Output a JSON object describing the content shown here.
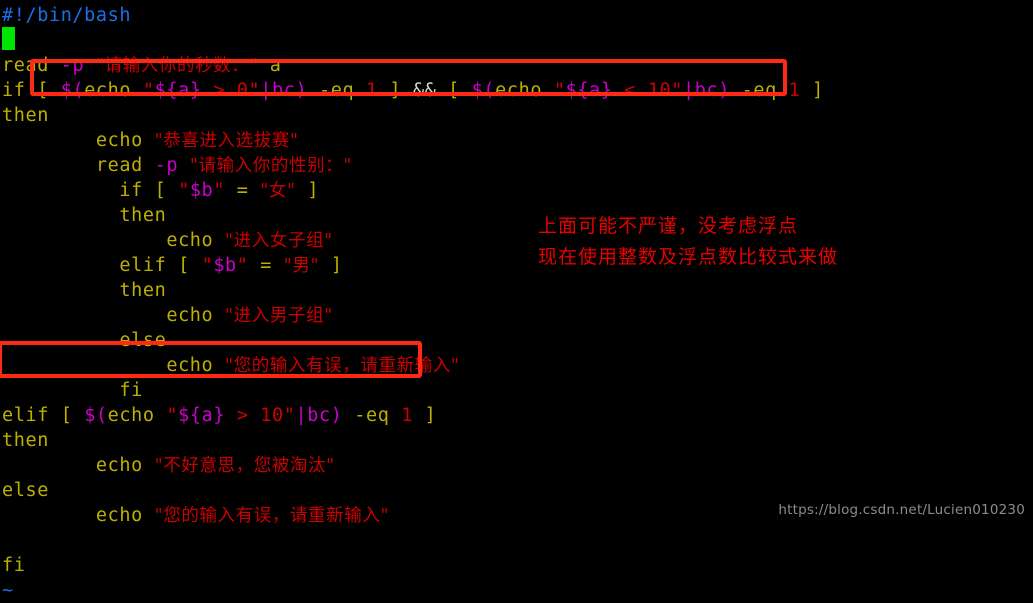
{
  "terminal": {
    "background": "#000000",
    "cursor_color": "#00e500",
    "colors": {
      "comment_blue": "#1a6fe8",
      "keyword_yellow": "#bdb000",
      "string_red": "#cc0000",
      "variable_magenta": "#cc00cc",
      "plain_white": "#d8d8d8",
      "highlight_red": "#ff2a15",
      "note_red": "#e80000",
      "watermark_gray": "#8c8c8c"
    }
  },
  "code": {
    "lines": [
      {
        "id": "line-1",
        "indent": 0,
        "tokens": [
          {
            "t": "#!/bin/bash",
            "c": "c-blue"
          }
        ]
      },
      {
        "id": "line-2",
        "indent": 0,
        "tokens": [
          {
            "t": "",
            "c": "c-white"
          }
        ]
      },
      {
        "id": "line-3",
        "indent": 0,
        "tokens": [
          {
            "t": "read ",
            "c": "c-yellow"
          },
          {
            "t": "-p",
            "c": "c-magenta"
          },
          {
            "t": " ",
            "c": "c-white"
          },
          {
            "t": "\"请输入你的秒数：\"",
            "c": "c-red cjk"
          },
          {
            "t": " a",
            "c": "c-yellow"
          }
        ]
      },
      {
        "id": "line-4",
        "indent": 0,
        "tokens": [
          {
            "t": "if ",
            "c": "c-yellow"
          },
          {
            "t": "[ ",
            "c": "c-yellow"
          },
          {
            "t": "$(",
            "c": "c-magenta"
          },
          {
            "t": "echo ",
            "c": "c-yellow"
          },
          {
            "t": "\"",
            "c": "c-red"
          },
          {
            "t": "${a}",
            "c": "c-magenta"
          },
          {
            "t": " > 0\"",
            "c": "c-red"
          },
          {
            "t": "|",
            "c": "c-magenta"
          },
          {
            "t": "bc)",
            "c": "c-magenta"
          },
          {
            "t": " -eq ",
            "c": "c-yellow"
          },
          {
            "t": "1",
            "c": "c-red"
          },
          {
            "t": " ]",
            "c": "c-yellow"
          },
          {
            "t": " && ",
            "c": "c-white"
          },
          {
            "t": "[ ",
            "c": "c-yellow"
          },
          {
            "t": "$(",
            "c": "c-magenta"
          },
          {
            "t": "echo ",
            "c": "c-yellow"
          },
          {
            "t": "\"",
            "c": "c-red"
          },
          {
            "t": "${a}",
            "c": "c-magenta"
          },
          {
            "t": " < 10\"",
            "c": "c-red"
          },
          {
            "t": "|",
            "c": "c-magenta"
          },
          {
            "t": "bc)",
            "c": "c-magenta"
          },
          {
            "t": " -eq ",
            "c": "c-yellow"
          },
          {
            "t": "1",
            "c": "c-red"
          },
          {
            "t": " ]",
            "c": "c-yellow"
          }
        ]
      },
      {
        "id": "line-5",
        "indent": 0,
        "tokens": [
          {
            "t": "then",
            "c": "c-yellow"
          }
        ]
      },
      {
        "id": "line-6",
        "indent": 0,
        "tokens": [
          {
            "t": "        echo ",
            "c": "c-yellow"
          },
          {
            "t": "\"恭喜进入选拔赛\"",
            "c": "c-red cjk"
          }
        ]
      },
      {
        "id": "line-7",
        "indent": 0,
        "tokens": [
          {
            "t": "        read ",
            "c": "c-yellow"
          },
          {
            "t": "-p",
            "c": "c-magenta"
          },
          {
            "t": " ",
            "c": "c-white"
          },
          {
            "t": "\"请输入你的性别：\"",
            "c": "c-red cjk"
          }
        ]
      },
      {
        "id": "line-8",
        "indent": 0,
        "tokens": [
          {
            "t": "          if ",
            "c": "c-yellow"
          },
          {
            "t": "[ ",
            "c": "c-yellow"
          },
          {
            "t": "\"",
            "c": "c-red"
          },
          {
            "t": "$b",
            "c": "c-magenta"
          },
          {
            "t": "\"",
            "c": "c-red"
          },
          {
            "t": " = ",
            "c": "c-yellow"
          },
          {
            "t": "\"女\"",
            "c": "c-red cjk"
          },
          {
            "t": " ]",
            "c": "c-yellow"
          }
        ]
      },
      {
        "id": "line-9",
        "indent": 0,
        "tokens": [
          {
            "t": "          then",
            "c": "c-yellow"
          }
        ]
      },
      {
        "id": "line-10",
        "indent": 0,
        "tokens": [
          {
            "t": "              echo ",
            "c": "c-yellow"
          },
          {
            "t": "\"进入女子组\"",
            "c": "c-red cjk"
          }
        ]
      },
      {
        "id": "line-11",
        "indent": 0,
        "tokens": [
          {
            "t": "          elif ",
            "c": "c-yellow"
          },
          {
            "t": "[ ",
            "c": "c-yellow"
          },
          {
            "t": "\"",
            "c": "c-red"
          },
          {
            "t": "$b",
            "c": "c-magenta"
          },
          {
            "t": "\"",
            "c": "c-red"
          },
          {
            "t": " = ",
            "c": "c-yellow"
          },
          {
            "t": "\"男\"",
            "c": "c-red cjk"
          },
          {
            "t": " ]",
            "c": "c-yellow"
          }
        ]
      },
      {
        "id": "line-12",
        "indent": 0,
        "tokens": [
          {
            "t": "          then",
            "c": "c-yellow"
          }
        ]
      },
      {
        "id": "line-13",
        "indent": 0,
        "tokens": [
          {
            "t": "              echo ",
            "c": "c-yellow"
          },
          {
            "t": "\"进入男子组\"",
            "c": "c-red cjk"
          }
        ]
      },
      {
        "id": "line-14",
        "indent": 0,
        "tokens": [
          {
            "t": "          else",
            "c": "c-yellow"
          }
        ]
      },
      {
        "id": "line-15",
        "indent": 0,
        "tokens": [
          {
            "t": "              echo ",
            "c": "c-yellow"
          },
          {
            "t": "\"您的输入有误，请重新输入\"",
            "c": "c-red cjk"
          }
        ]
      },
      {
        "id": "line-16",
        "indent": 0,
        "tokens": [
          {
            "t": "          fi",
            "c": "c-yellow"
          }
        ]
      },
      {
        "id": "line-17",
        "indent": 0,
        "tokens": [
          {
            "t": "elif ",
            "c": "c-yellow"
          },
          {
            "t": "[ ",
            "c": "c-yellow"
          },
          {
            "t": "$(",
            "c": "c-magenta"
          },
          {
            "t": "echo ",
            "c": "c-yellow"
          },
          {
            "t": "\"",
            "c": "c-red"
          },
          {
            "t": "${a}",
            "c": "c-magenta"
          },
          {
            "t": " > 10\"",
            "c": "c-red"
          },
          {
            "t": "|",
            "c": "c-magenta"
          },
          {
            "t": "bc)",
            "c": "c-magenta"
          },
          {
            "t": " -eq ",
            "c": "c-yellow"
          },
          {
            "t": "1",
            "c": "c-red"
          },
          {
            "t": " ]",
            "c": "c-yellow"
          }
        ]
      },
      {
        "id": "line-18",
        "indent": 0,
        "tokens": [
          {
            "t": "then",
            "c": "c-yellow"
          }
        ]
      },
      {
        "id": "line-19",
        "indent": 0,
        "tokens": [
          {
            "t": "        echo ",
            "c": "c-yellow"
          },
          {
            "t": "\"不好意思，您被淘汰\"",
            "c": "c-red cjk"
          }
        ]
      },
      {
        "id": "line-20",
        "indent": 0,
        "tokens": [
          {
            "t": "else",
            "c": "c-yellow"
          }
        ]
      },
      {
        "id": "line-21",
        "indent": 0,
        "tokens": [
          {
            "t": "        echo ",
            "c": "c-yellow"
          },
          {
            "t": "\"您的输入有误，请重新输入\"",
            "c": "c-red cjk"
          }
        ]
      },
      {
        "id": "line-22",
        "indent": 0,
        "tokens": [
          {
            "t": "",
            "c": "c-white"
          }
        ]
      },
      {
        "id": "line-23",
        "indent": 0,
        "tokens": [
          {
            "t": "fi",
            "c": "c-yellow"
          }
        ]
      },
      {
        "id": "line-24",
        "indent": 0,
        "tokens": [
          {
            "t": "~",
            "c": "c-tilde"
          }
        ]
      }
    ]
  },
  "annotations": {
    "note_line_1": "上面可能不严谨，没考虑浮点",
    "note_line_2": "现在使用整数及浮点数比较式来做",
    "highlight_boxes": [
      {
        "name": "if-condition-highlight",
        "label": "if [ $(echo \"${a} > 0\"|bc) -eq 1 ] && [ $(echo \"${a} < 10\"|bc) -eq 1 ]"
      },
      {
        "name": "elif-condition-highlight",
        "label": "elif [ $(echo \"${a} > 10\"|bc) -eq 1 ]"
      }
    ]
  },
  "watermark": {
    "text": "https://blog.csdn.net/Lucien010230"
  }
}
